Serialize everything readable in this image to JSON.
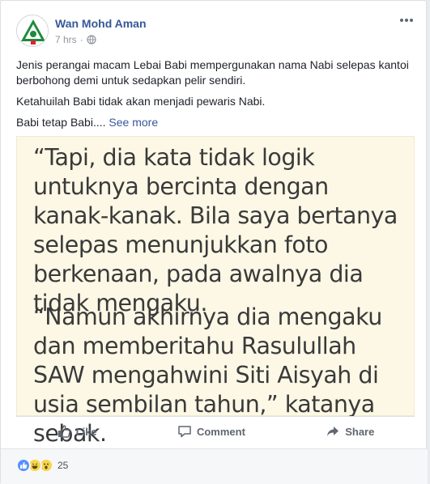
{
  "post": {
    "author": "Wan Mohd Aman",
    "time": "7 hrs",
    "separator": "·",
    "text_lines": [
      "Jenis perangai macam Lebai Babi mempergunakan nama Nabi selepas kantoi berbohong demi untuk sedapkan pelir sendiri.",
      "Ketahuilah Babi tidak akan menjadi pewaris Nabi.",
      "Babi tetap Babi...."
    ],
    "see_more": "See more"
  },
  "image_quote": {
    "paragraph_1": "“Tapi, dia kata tidak logik untuknya bercinta dengan kanak-kanak. Bila saya bertanya selepas menunjukkan foto berkenaan, pada awalnya dia tidak mengaku.",
    "paragraph_2": "“Namun akhirnya dia mengaku dan memberitahu Rasulullah SAW mengahwini Siti Aisyah di usia sembilan tahun,” katanya sebak."
  },
  "actions": {
    "like": "Like",
    "comment": "Comment",
    "share": "Share"
  },
  "reactions": {
    "types": [
      "like-icon",
      "haha-icon",
      "wow-icon"
    ],
    "count": "25"
  },
  "colors": {
    "link": "#365899",
    "muted": "#90949c",
    "quote_background": "#fdf8e6"
  }
}
